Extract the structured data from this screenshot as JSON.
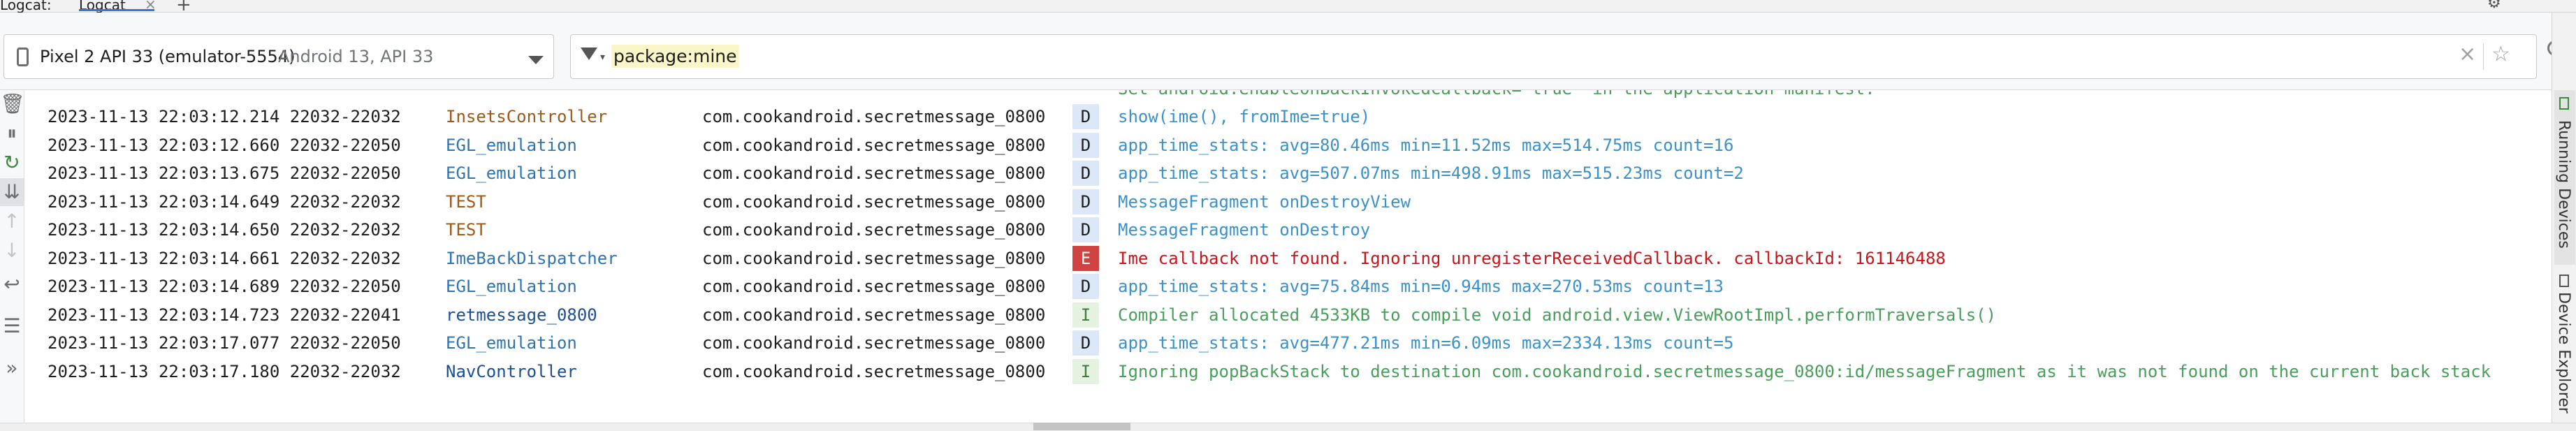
{
  "header": {
    "panel_label": "Logcat:",
    "tab_label": "Logcat",
    "close_glyph": "×",
    "add_glyph": "+"
  },
  "device": {
    "name": "Pixel 2 API 33 (emulator-5554)",
    "sub": "Android 13, API 33"
  },
  "filter": {
    "query": "package:mine"
  },
  "log": {
    "truncated_line": "Set android:enableOnBackInvokedCallback=\"true\" in the application manifest.",
    "rows": [
      {
        "ts": "2023-11-13 22:03:12.214 22032-22032",
        "tag": "InsetsController",
        "pkg": "com.cookandroid.secretmessage_0800",
        "level": "D",
        "msg": "show(ime(), fromIme=true)"
      },
      {
        "ts": "2023-11-13 22:03:12.660 22032-22050",
        "tag": "EGL_emulation",
        "pkg": "com.cookandroid.secretmessage_0800",
        "level": "D",
        "msg": "app_time_stats: avg=80.46ms min=11.52ms max=514.75ms count=16"
      },
      {
        "ts": "2023-11-13 22:03:13.675 22032-22050",
        "tag": "EGL_emulation",
        "pkg": "com.cookandroid.secretmessage_0800",
        "level": "D",
        "msg": "app_time_stats: avg=507.07ms min=498.91ms max=515.23ms count=2"
      },
      {
        "ts": "2023-11-13 22:03:14.649 22032-22032",
        "tag": "TEST",
        "pkg": "com.cookandroid.secretmessage_0800",
        "level": "D",
        "msg": "MessageFragment onDestroyView"
      },
      {
        "ts": "2023-11-13 22:03:14.650 22032-22032",
        "tag": "TEST",
        "pkg": "com.cookandroid.secretmessage_0800",
        "level": "D",
        "msg": "MessageFragment onDestroy"
      },
      {
        "ts": "2023-11-13 22:03:14.661 22032-22032",
        "tag": "ImeBackDispatcher",
        "pkg": "com.cookandroid.secretmessage_0800",
        "level": "E",
        "msg": "Ime callback not found. Ignoring unregisterReceivedCallback. callbackId: 161146488"
      },
      {
        "ts": "2023-11-13 22:03:14.689 22032-22050",
        "tag": "EGL_emulation",
        "pkg": "com.cookandroid.secretmessage_0800",
        "level": "D",
        "msg": "app_time_stats: avg=75.84ms min=0.94ms max=270.53ms count=13"
      },
      {
        "ts": "2023-11-13 22:03:14.723 22032-22041",
        "tag": "retmessage_0800",
        "pkg": "com.cookandroid.secretmessage_0800",
        "level": "I",
        "msg": "Compiler allocated 4533KB to compile void android.view.ViewRootImpl.performTraversals()"
      },
      {
        "ts": "2023-11-13 22:03:17.077 22032-22050",
        "tag": "EGL_emulation",
        "pkg": "com.cookandroid.secretmessage_0800",
        "level": "D",
        "msg": "app_time_stats: avg=477.21ms min=6.09ms max=2334.13ms count=5"
      },
      {
        "ts": "2023-11-13 22:03:17.180 22032-22032",
        "tag": "NavController",
        "pkg": "com.cookandroid.secretmessage_0800",
        "level": "I",
        "msg": "Ignoring popBackStack to destination com.cookandroid.secretmessage_0800:id/messageFragment as it was not found on the current back stack"
      }
    ]
  },
  "side_panel": {
    "running_devices": "Running Devices",
    "device_explorer": "Device Explorer"
  },
  "icons": {
    "toolbar": [
      "trash-icon",
      "pause-icon",
      "restart-icon",
      "scroll-to-end-icon",
      "up-arrow-icon",
      "down-arrow-icon",
      "soft-wrap-icon",
      "filter-settings-icon",
      "more-icon"
    ]
  },
  "colors": {
    "level_D_bg": "#dce8f7",
    "level_E_bg": "#cf4343",
    "level_I_bg": "#e5f2e1",
    "msg_D": "#3b91c9",
    "msg_E": "#c7161b",
    "msg_I": "#4a9e5c",
    "accent": "#3574f0"
  }
}
